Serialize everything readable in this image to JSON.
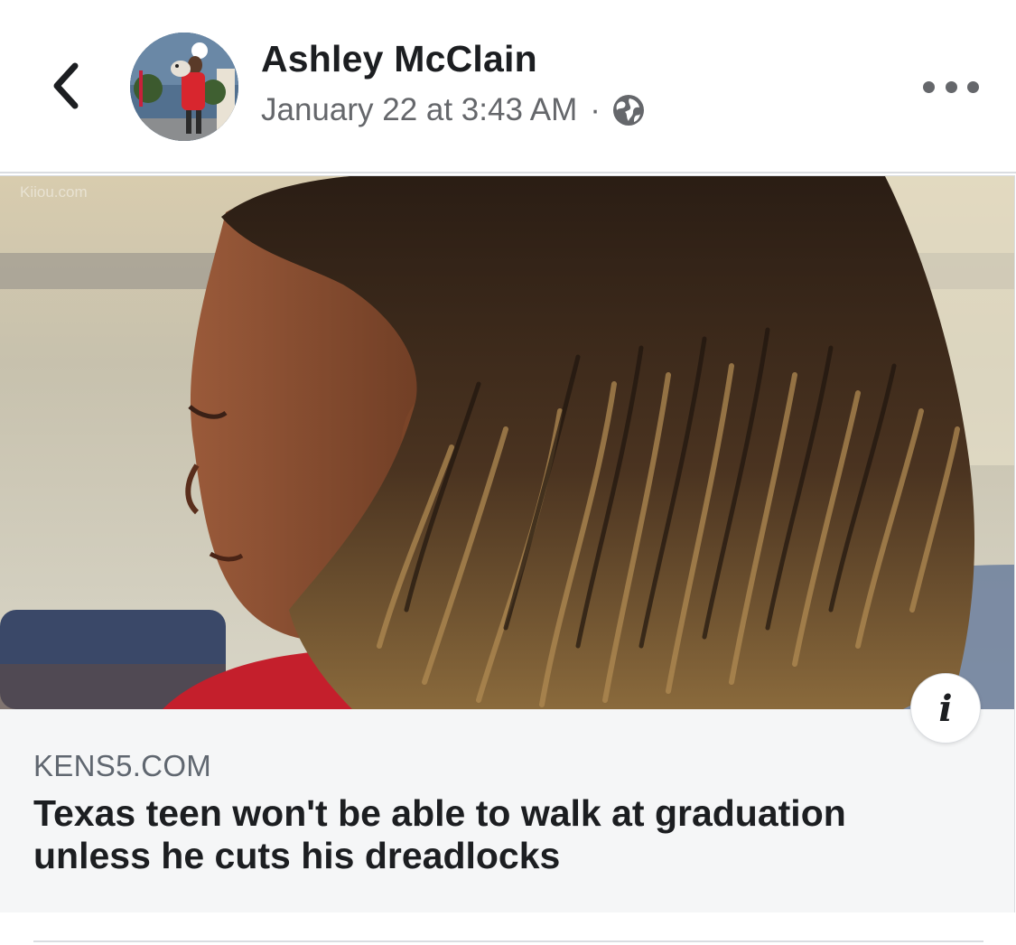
{
  "post": {
    "author": "Ashley McClain",
    "timestamp": "January 22 at 3:43 AM",
    "separator": "·",
    "privacy_icon": "globe-icon"
  },
  "toolbar": {
    "back_icon": "chevron-left-icon",
    "more_icon": "more-horizontal-icon"
  },
  "link_preview": {
    "domain": "KENS5.COM",
    "headline": "Texas teen won't be able to walk at graduation unless he cuts his dreadlocks",
    "image_watermark": "Kiiou.com",
    "info_icon": "info-icon"
  },
  "colors": {
    "primary_text": "#1c1e21",
    "secondary_text": "#65676b",
    "link_footer_bg": "#f5f6f7",
    "divider": "#dadde1"
  }
}
